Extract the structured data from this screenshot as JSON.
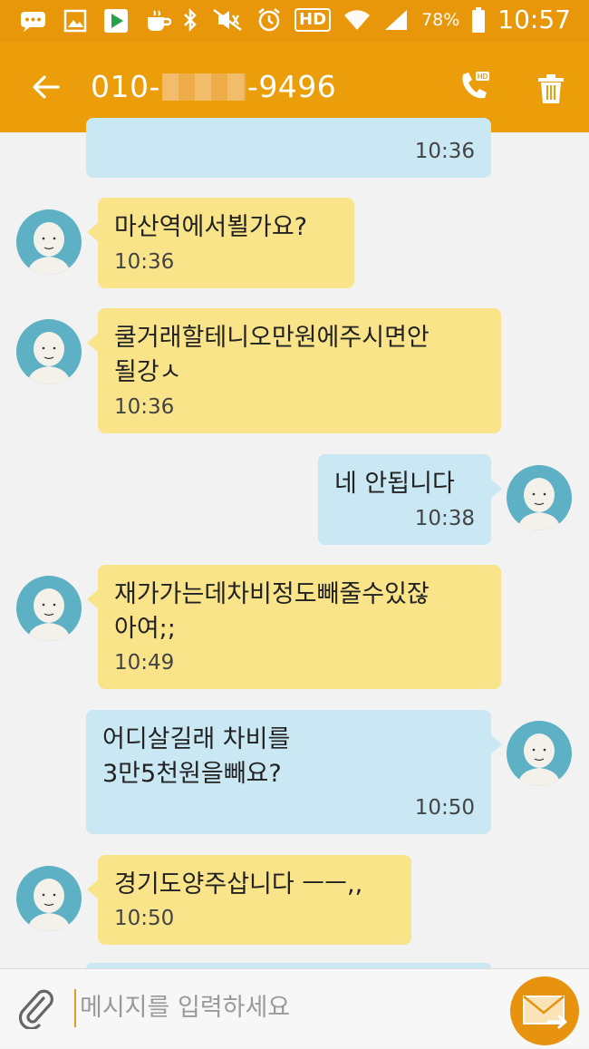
{
  "status_bar": {
    "battery": "78%",
    "time": "10:57",
    "hd_label": "HD"
  },
  "header": {
    "phone_prefix": "010-",
    "phone_suffix": "-9496",
    "call_hd": "HD"
  },
  "messages": [
    {
      "side": "out",
      "text": "",
      "time": "10:36"
    },
    {
      "side": "in",
      "text": "마산역에서뵐가요?",
      "time": "10:36"
    },
    {
      "side": "in",
      "text": "쿨거래할테니오만원에주시면안\n될강ㅅ",
      "time": "10:36"
    },
    {
      "side": "out",
      "text": "네 안됩니다",
      "time": "10:38"
    },
    {
      "side": "in",
      "text": "재가가는데차비정도빼줄수있잖\n아여;;",
      "time": "10:49"
    },
    {
      "side": "out",
      "text": "어디살길래 차비를\n3만5천원을빼요?",
      "time": "10:50"
    },
    {
      "side": "in",
      "text": "경기도양주삽니다 ㅡㅡ,,",
      "time": "10:50"
    }
  ],
  "composer": {
    "placeholder": "메시지를 입력하세요"
  },
  "colors": {
    "accent": "#eb9d0a",
    "incoming_bubble": "#f9e48a",
    "outgoing_bubble": "#c9e8f4",
    "avatar": "#5eb0c4"
  },
  "icons": {
    "back": "arrow-left-icon",
    "call": "phone-hd-icon",
    "delete": "trash-icon",
    "attach": "paperclip-icon",
    "send": "envelope-send-icon"
  }
}
